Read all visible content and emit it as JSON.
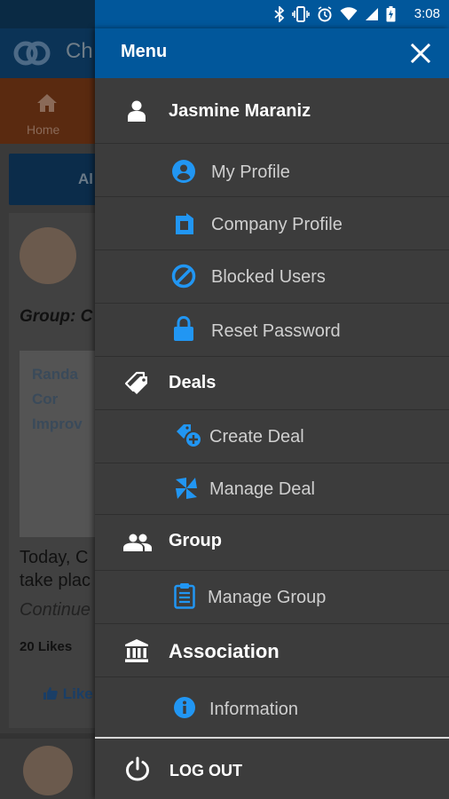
{
  "status_bar": {
    "time": "3:08"
  },
  "background": {
    "app_title": "Ch",
    "nav_home": "Home",
    "tab_label": "Al",
    "group_text": "Group: C",
    "image_text": "Randa\nCor\nImprov",
    "body_text": "Today, C\ntake plac",
    "continue_text": "Continue",
    "likes_text": "20 Likes",
    "like_button": "Like"
  },
  "drawer": {
    "title": "Menu",
    "user": {
      "name": "Jasmine  Maraniz",
      "items": [
        {
          "label": "My Profile",
          "icon": "account-circle-icon"
        },
        {
          "label": "Company Profile",
          "icon": "company-icon"
        },
        {
          "label": "Blocked Users",
          "icon": "block-icon"
        },
        {
          "label": "Reset Password",
          "icon": "lock-icon"
        }
      ]
    },
    "deals": {
      "label": "Deals",
      "items": [
        {
          "label": "Create Deal",
          "icon": "create-deal-icon"
        },
        {
          "label": "Manage Deal",
          "icon": "manage-deal-icon"
        }
      ]
    },
    "group": {
      "label": "Group",
      "items": [
        {
          "label": "Manage Group",
          "icon": "clipboard-icon"
        }
      ]
    },
    "association": {
      "label": "Association",
      "items": [
        {
          "label": "Information",
          "icon": "info-icon"
        }
      ]
    },
    "logout_label": "LOG OUT"
  },
  "colors": {
    "accent_blue": "#2196f3",
    "header_blue": "#01579b",
    "drawer_bg": "#3c3c3c"
  }
}
